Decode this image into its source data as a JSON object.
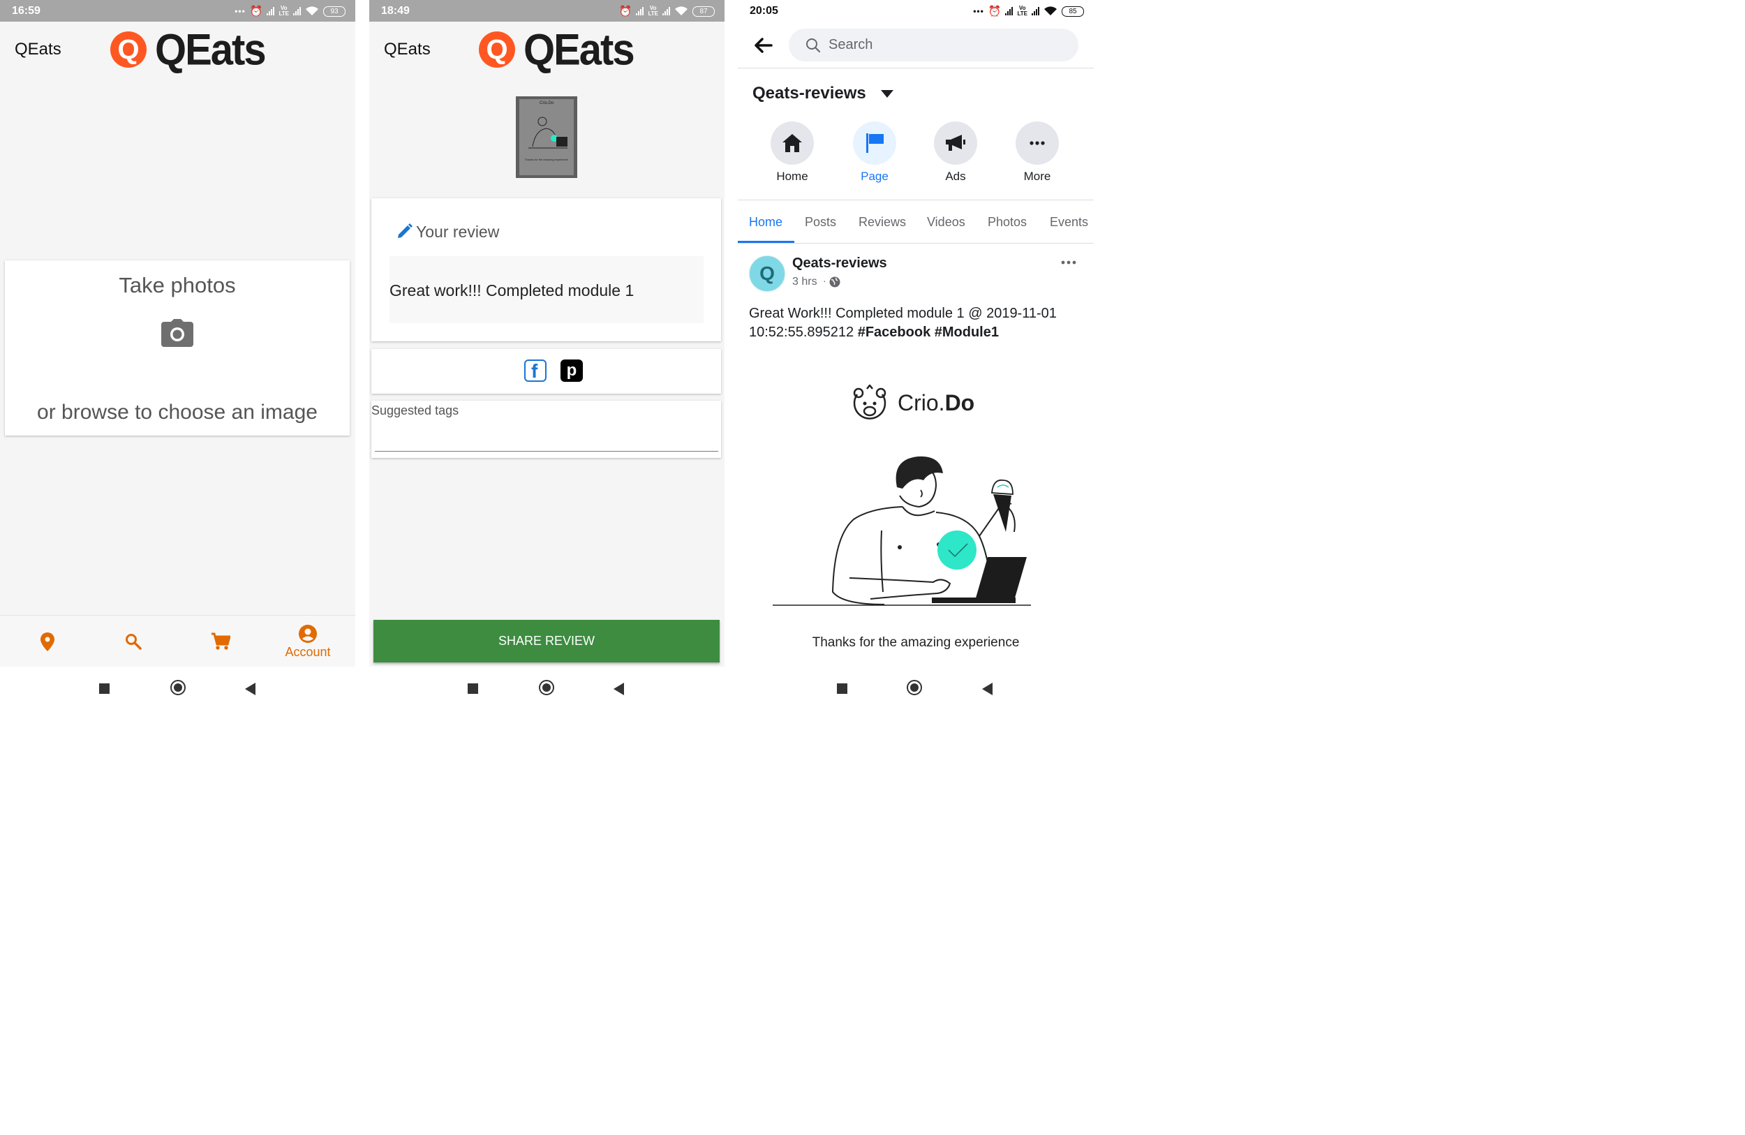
{
  "phone1": {
    "time": "16:59",
    "battery": "93",
    "app_title": "QEats",
    "logo_letter": "Q",
    "logo_text": "QEats",
    "take_photos": "Take photos",
    "browse_text": "or browse to choose an image",
    "nav_account": "Account"
  },
  "phone2": {
    "time": "18:49",
    "battery": "87",
    "app_title": "QEats",
    "logo_letter": "Q",
    "logo_text": "QEats",
    "thumb_brand": "Crio.Do",
    "thumb_caption": "Thanks for the amazing experience",
    "review_heading": "Your review",
    "review_text": "Great work!!! Completed module 1",
    "suggested_tags_label": "Suggested tags",
    "share_button": "SHARE REVIEW"
  },
  "phone3": {
    "time": "20:05",
    "battery": "85",
    "search_placeholder": "Search",
    "page_name": "Qeats-reviews",
    "actions": [
      "Home",
      "Page",
      "Ads",
      "More"
    ],
    "tabs": [
      "Home",
      "Posts",
      "Reviews",
      "Videos",
      "Photos",
      "Events"
    ],
    "post": {
      "avatar_letter": "Q",
      "author": "Qeats-reviews",
      "time": "3 hrs",
      "text_line1": "Great Work!!! Completed module 1 @ 2019-11-01",
      "text_line2_plain": "10:52:55.895212 ",
      "hashtag1": "#Facebook",
      "hashtag2": "#Module1",
      "image_brand": "Crio.",
      "image_brand_bold": "Do",
      "image_caption": "Thanks for the amazing experience"
    }
  },
  "colors": {
    "accent_orange": "#e26a00",
    "qeats_red": "#ff5722",
    "share_green": "#3d8c40",
    "fb_blue": "#1877f2",
    "teal": "#2ee6c8"
  }
}
